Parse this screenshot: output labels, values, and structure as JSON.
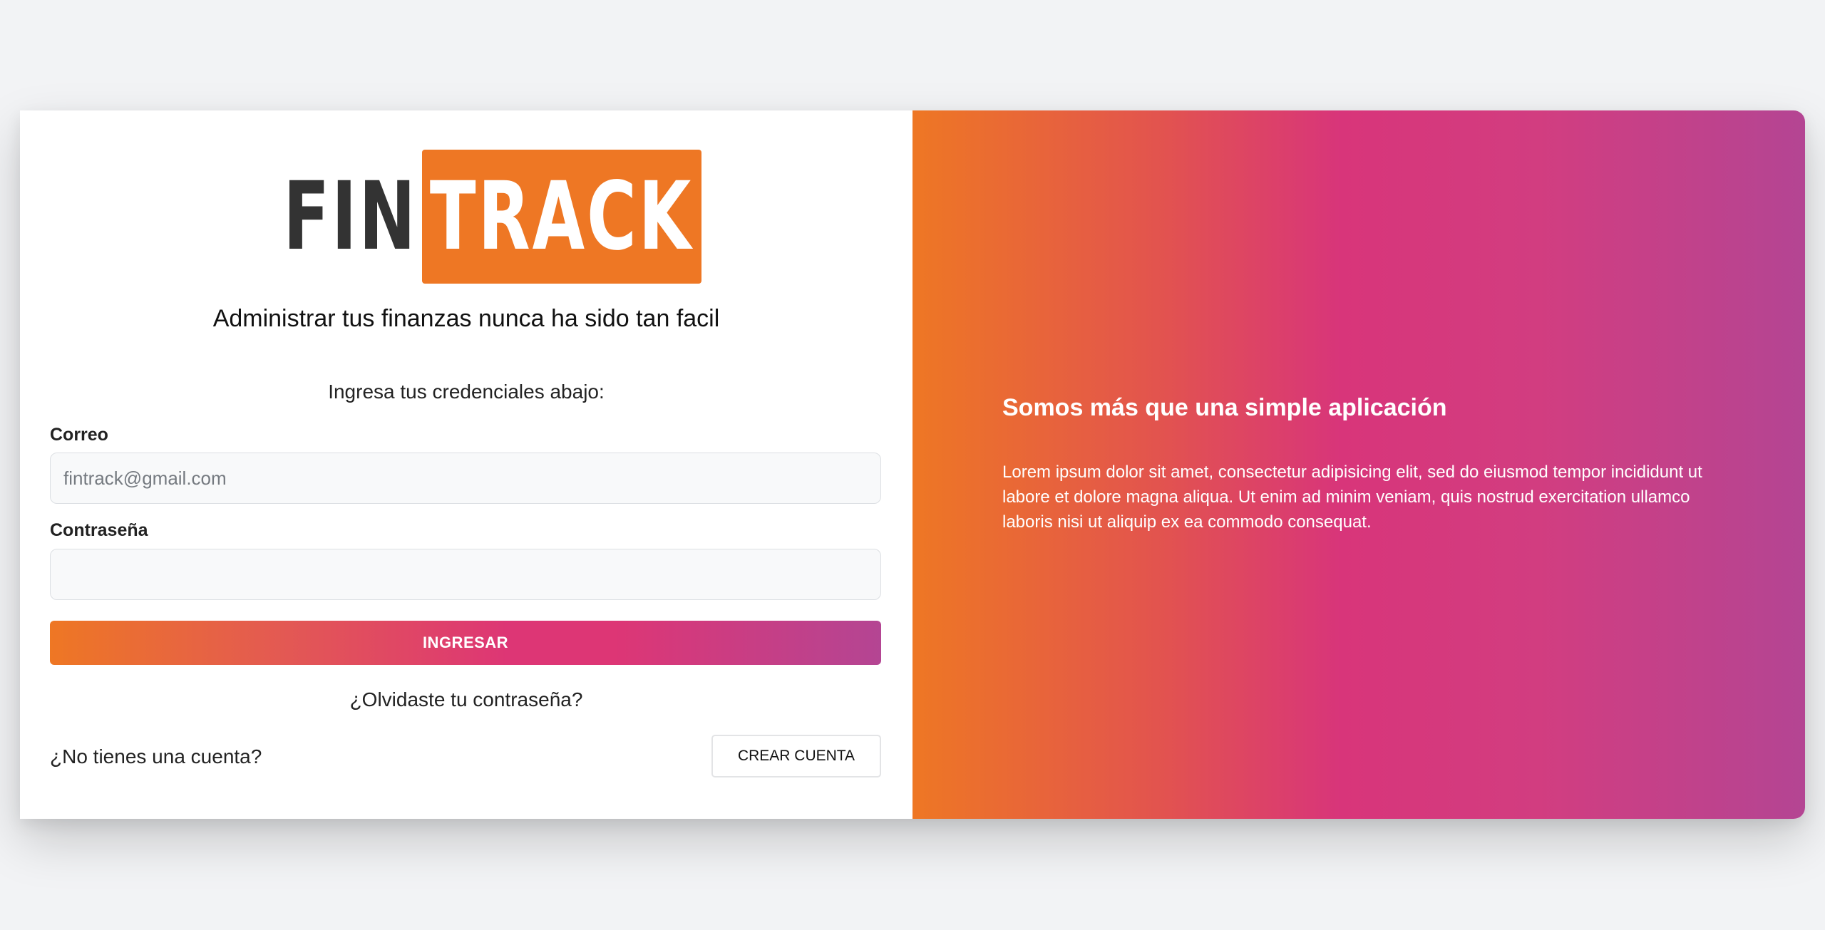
{
  "logo": {
    "part1": "FIN",
    "part2": "TRACK"
  },
  "tagline": "Administrar tus finanzas nunca ha sido tan facil",
  "instruction": "Ingresa tus credenciales abajo:",
  "form": {
    "email_label": "Correo",
    "email_placeholder": "fintrack@gmail.com",
    "email_value": "",
    "password_label": "Contraseña",
    "password_value": "",
    "submit_label": "INGRESAR",
    "forgot_link": "¿Olvidaste tu contraseña?"
  },
  "signup": {
    "prompt": "¿No tienes una cuenta?",
    "button_label": "CREAR CUENTA"
  },
  "promo": {
    "title": "Somos más que una simple aplicación",
    "text": "Lorem ipsum dolor sit amet, consectetur adipisicing elit, sed do eiusmod tempor incididunt ut labore et dolore magna aliqua. Ut enim ad minim veniam, quis nostrud exercitation ullamco laboris nisi ut aliquip ex ea commodo consequat."
  },
  "colors": {
    "brand_orange": "#ee7724",
    "gradient": [
      "#ee7724",
      "#d8363a",
      "#dd3675",
      "#b44593"
    ],
    "logo_dark": "#333333",
    "page_background": "#f2f3f5"
  }
}
